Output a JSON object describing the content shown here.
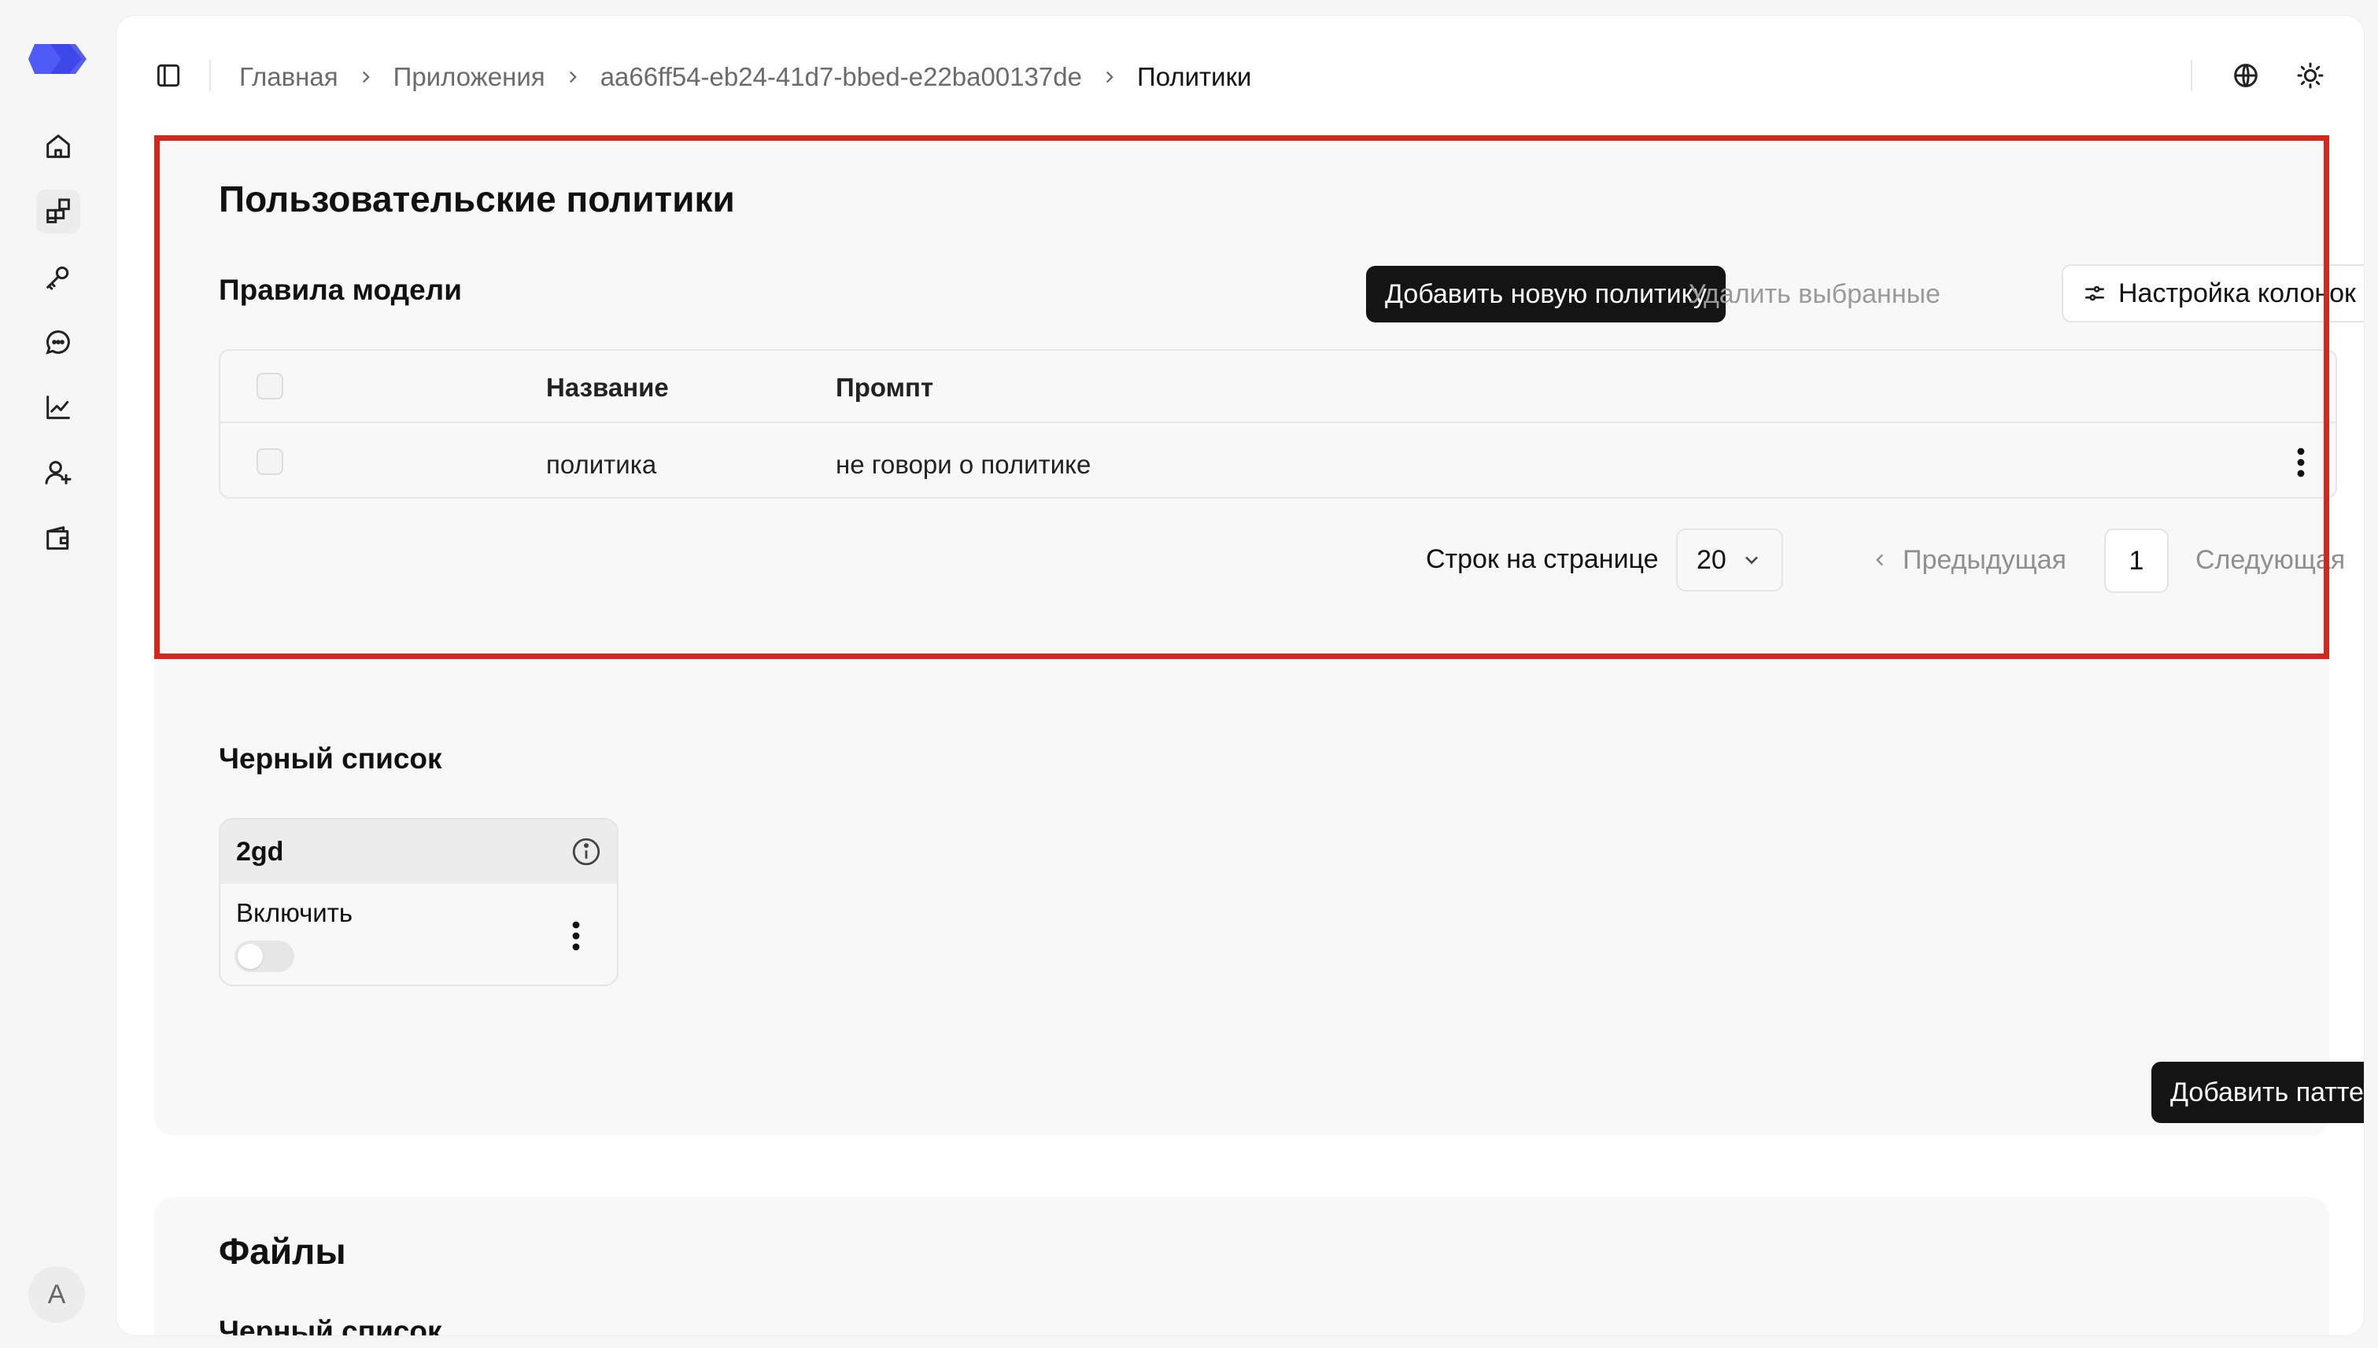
{
  "breadcrumb": {
    "items": [
      "Главная",
      "Приложения",
      "aa66ff54-eb24-41d7-bbed-e22ba00137de"
    ],
    "current": "Политики"
  },
  "policies": {
    "title": "Пользовательские политики",
    "subtitle": "Правила модели",
    "add_button": "Добавить новую политику",
    "delete_button": "Удалить выбранные",
    "columns_button": "Настройка колонок",
    "table": {
      "headers": [
        "Название",
        "Промпт"
      ],
      "rows": [
        {
          "name": "политика",
          "prompt": "не говори о политике"
        }
      ]
    },
    "pager": {
      "rows_label": "Строк на странице",
      "rows_value": "20",
      "prev": "Предыдущая",
      "page": "1",
      "next": "Следующая"
    }
  },
  "blacklist": {
    "title": "Черный список",
    "card": {
      "name": "2gd",
      "toggle_label": "Включить",
      "enabled": false
    },
    "add_pattern_button": "Добавить паттерн"
  },
  "files": {
    "title": "Файлы",
    "subtitle": "Черный список"
  },
  "user": {
    "avatar_initial": "A"
  },
  "colors": {
    "accent": "#4f5bf5",
    "highlight": "#d4281c",
    "dark_button": "#141414"
  }
}
